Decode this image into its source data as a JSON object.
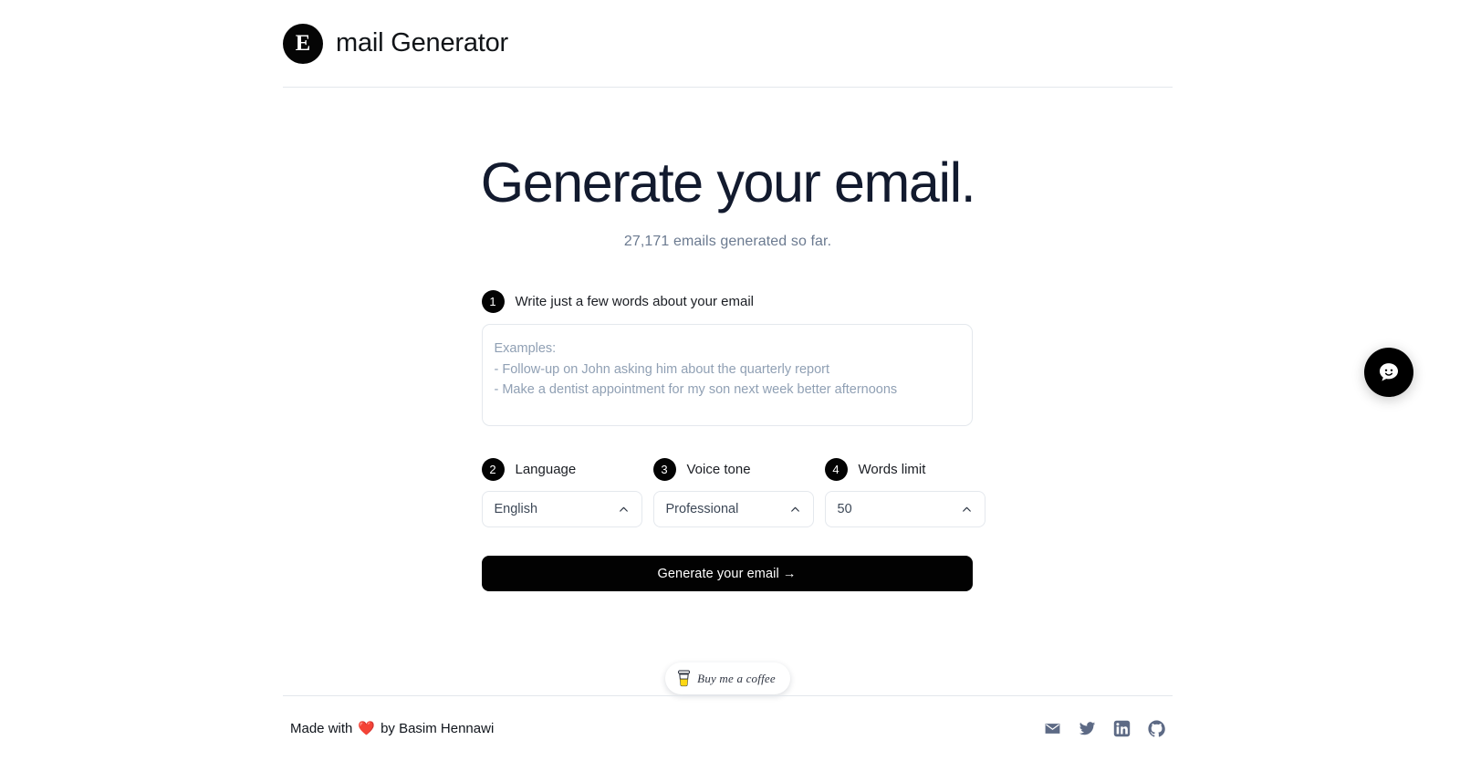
{
  "header": {
    "logo_letter": "E",
    "logo_icon": "circle-e-logo",
    "title": "mail Generator"
  },
  "hero": {
    "title": "Generate your email.",
    "subtitle": "27,171 emails generated so far."
  },
  "form": {
    "step1": {
      "number": "1",
      "label": "Write just a few words about your email",
      "placeholder": "Examples:\n- Follow-up on John asking him about the quarterly report\n- Make a dentist appointment for my son next week better afternoons",
      "value": ""
    },
    "step2": {
      "number": "2",
      "label": "Language",
      "value": "English"
    },
    "step3": {
      "number": "3",
      "label": "Voice tone",
      "value": "Professional"
    },
    "step4": {
      "number": "4",
      "label": "Words limit",
      "value": "50"
    },
    "submit_label": "Generate your email →"
  },
  "coffee": {
    "label": "Buy me a coffee",
    "icon": "coffee-cup-icon"
  },
  "footer": {
    "made_with": "Made with",
    "heart": "❤️",
    "by": "by Basim Hennawi",
    "socials": [
      {
        "name": "email-icon"
      },
      {
        "name": "twitter-icon"
      },
      {
        "name": "linkedin-icon"
      },
      {
        "name": "github-icon"
      }
    ]
  },
  "chat": {
    "icon": "chat-smiley-icon"
  },
  "colors": {
    "accent": "#000000",
    "heading": "#121a2e",
    "muted": "#6b7a90",
    "border": "#e4e8ed",
    "social": "#5d6a85"
  }
}
